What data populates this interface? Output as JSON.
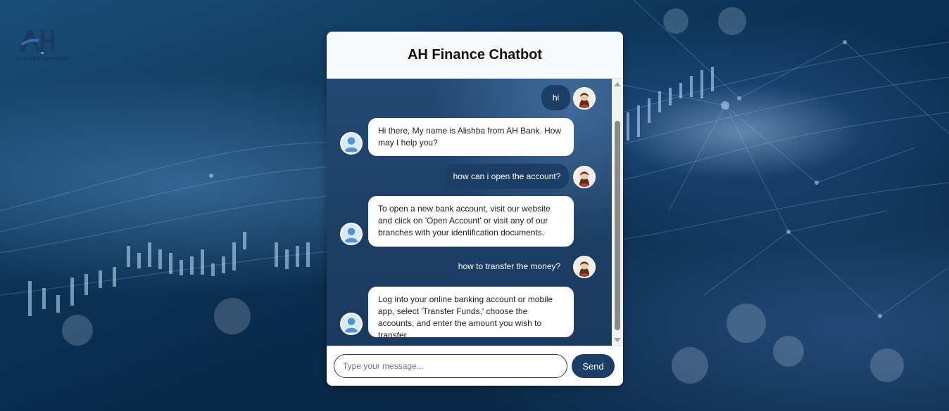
{
  "brand": {
    "logo_text": "AH",
    "logo_caption": "ALISHBA HAROON"
  },
  "chat": {
    "title": "AH Finance Chatbot",
    "messages": [
      {
        "sender": "user",
        "text": "hi"
      },
      {
        "sender": "bot",
        "text": "Hi there, My name is Alishba from AH Bank. How may I help you?"
      },
      {
        "sender": "user",
        "text": "how can i open the account?"
      },
      {
        "sender": "bot",
        "text": "To open a new bank account, visit our website and click on 'Open Account' or visit any of our branches with your identification documents."
      },
      {
        "sender": "user",
        "text": "how to transfer the money?"
      },
      {
        "sender": "bot",
        "text": "Log into your online banking account or mobile app, select 'Transfer Funds,' choose the accounts, and enter the amount you wish to transfer."
      }
    ],
    "input": {
      "placeholder": "Type your message...",
      "value": ""
    },
    "send_label": "Send"
  },
  "colors": {
    "accent": "#1c3d66",
    "bot_bubble": "#ffffff",
    "user_bubble": "#1c3d66",
    "header_bg": "#f8f9fa"
  },
  "icons": {
    "user_avatar": "woman-avatar-icon",
    "bot_avatar": "user-profile-icon"
  }
}
